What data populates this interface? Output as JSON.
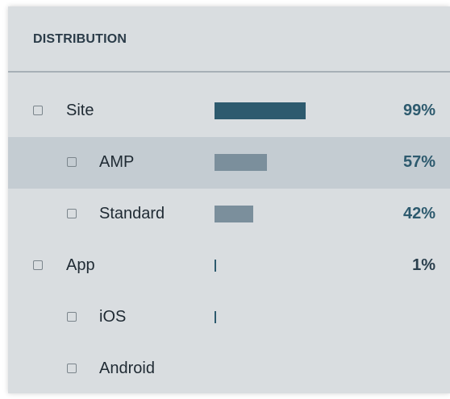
{
  "panel": {
    "title": "DISTRIBUTION"
  },
  "rows": [
    {
      "label": "Site",
      "percent": "99%",
      "bar_fraction": 0.99,
      "bar_color": "#2d5a6e"
    },
    {
      "label": "AMP",
      "percent": "57%",
      "bar_fraction": 0.57,
      "bar_color": "#7b8f9c"
    },
    {
      "label": "Standard",
      "percent": "42%",
      "bar_fraction": 0.42,
      "bar_color": "#7b8f9c"
    },
    {
      "label": "App",
      "percent": "1%",
      "bar_fraction": 0.01,
      "bar_color": "#2d5a6e"
    },
    {
      "label": "iOS",
      "percent": "",
      "bar_fraction": 0.0,
      "bar_color": "#7b8f9c"
    },
    {
      "label": "Android",
      "percent": "",
      "bar_fraction": null,
      "bar_color": "#7b8f9c"
    }
  ],
  "colors": {
    "panel_bg": "#d9dde0",
    "selected_row_bg": "#c4ccd2",
    "accent_bar": "#2d5a6e",
    "muted_bar": "#7b8f9c"
  }
}
